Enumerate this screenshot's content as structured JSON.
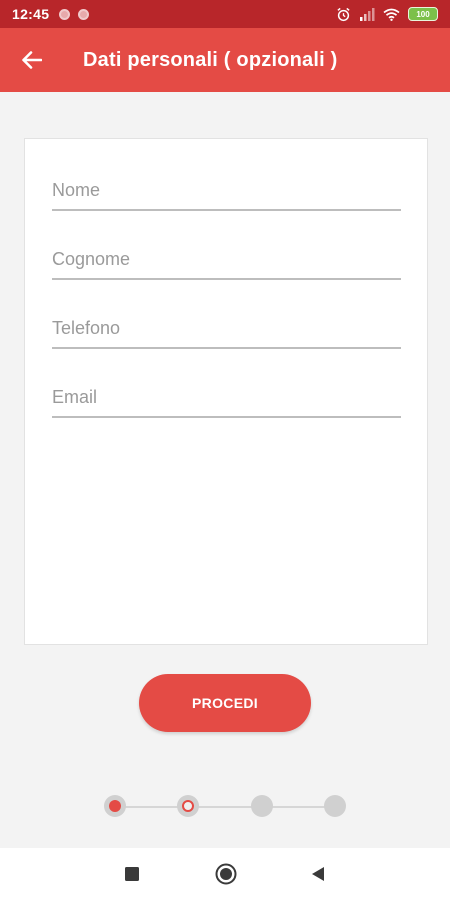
{
  "status_bar": {
    "time": "12:45",
    "battery": "100"
  },
  "app_bar": {
    "title": "Dati personali ( opzionali )",
    "back_icon": "arrow-left-icon"
  },
  "form": {
    "fields": [
      {
        "placeholder": "Nome",
        "value": ""
      },
      {
        "placeholder": "Cognome",
        "value": ""
      },
      {
        "placeholder": "Telefono",
        "value": ""
      },
      {
        "placeholder": "Email",
        "value": ""
      }
    ]
  },
  "actions": {
    "proceed_label": "PROCEDI"
  },
  "stepper": {
    "total_steps": 4,
    "current_step": 2
  },
  "nav_bar": {
    "icons": [
      "recents-square-icon",
      "home-circle-icon",
      "back-triangle-icon"
    ]
  },
  "colors": {
    "status_bar": "#b8262a",
    "primary": "#e44b45",
    "background": "#f3f3f3",
    "inactive_step": "#d0d0d0"
  }
}
